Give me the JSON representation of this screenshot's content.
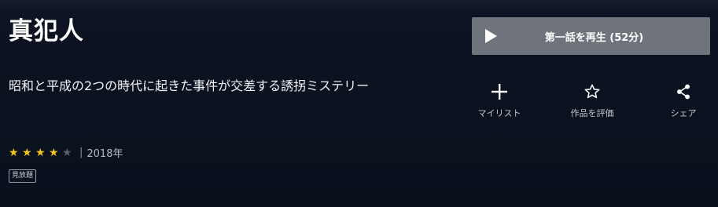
{
  "title": "真犯人",
  "description": "昭和と平成の2つの時代に起きた事件が交差する誘拐ミステリー",
  "rating": {
    "filled": 4,
    "total": 5
  },
  "year": "2018年",
  "separator": "|",
  "badge": "見放題",
  "play_button": {
    "label": "第一話を再生 (52分)"
  },
  "actions": {
    "mylist": {
      "label": "マイリスト",
      "icon": "plus-icon"
    },
    "rate": {
      "label": "作品を評価",
      "icon": "star-outline-icon"
    },
    "share": {
      "label": "シェア",
      "icon": "share-icon"
    }
  },
  "colors": {
    "background": "#0b1220",
    "star_on": "#f5c518",
    "star_off": "#5b626e",
    "button": "#6f747c"
  }
}
